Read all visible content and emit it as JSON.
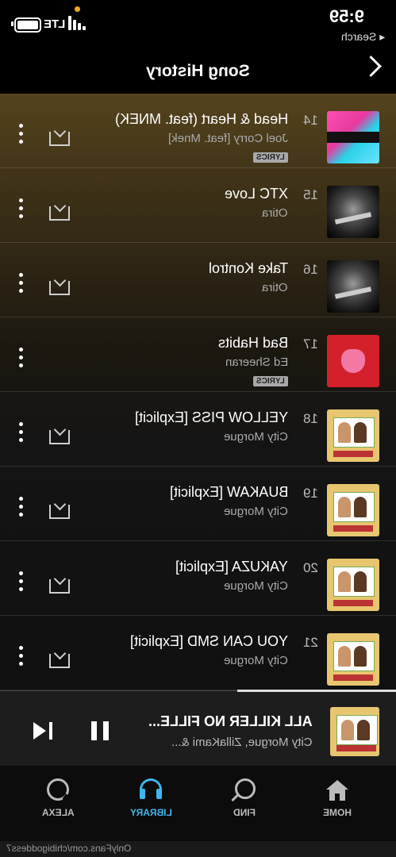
{
  "status": {
    "time": "9:59",
    "back_label": "◂ Search",
    "network": "LTE"
  },
  "header": {
    "title": "Song History"
  },
  "songs": [
    {
      "num": "14",
      "title": "Head & Heart (feat. MNEK)",
      "artist": "Joel Corry [feat. Mnek]",
      "lyrics": "LYRICS",
      "art": "head-heart",
      "download": true
    },
    {
      "num": "15",
      "title": "XTC Love",
      "artist": "Otira",
      "lyrics": "",
      "art": "otira",
      "download": true
    },
    {
      "num": "16",
      "title": "Take Kontrol",
      "artist": "Otira",
      "lyrics": "",
      "art": "otira",
      "download": true
    },
    {
      "num": "17",
      "title": "Bad Habits",
      "artist": "Ed Sheeran",
      "lyrics": "LYRICS",
      "art": "bad-habits",
      "download": false
    },
    {
      "num": "18",
      "title": "YELLOW PISS [Explicit]",
      "artist": "City Morgue",
      "lyrics": "",
      "art": "city-morgue",
      "download": true
    },
    {
      "num": "19",
      "title": "BUAKAW [Explicit]",
      "artist": "City Morgue",
      "lyrics": "",
      "art": "city-morgue",
      "download": true
    },
    {
      "num": "20",
      "title": "YAKUZA [Explicit]",
      "artist": "City Morgue",
      "lyrics": "",
      "art": "city-morgue",
      "download": true
    },
    {
      "num": "21",
      "title": "YOU CAN SMD [Explicit]",
      "artist": "City Morgue",
      "lyrics": "",
      "art": "city-morgue",
      "download": true
    }
  ],
  "now_playing": {
    "title": "ALL KILLER NO FILLE...",
    "artist": "City Morgue, ZillaKami &...",
    "progress": 0.4
  },
  "tabs": [
    {
      "label": "HOME",
      "icon": "home-icon",
      "active": false
    },
    {
      "label": "FIND",
      "icon": "search-icon",
      "active": false
    },
    {
      "label": "LIBRARY",
      "icon": "headphones-icon",
      "active": true
    },
    {
      "label": "ALEXA",
      "icon": "alexa-icon",
      "active": false
    }
  ],
  "watermark": "OnlyFans.com/chibigoddess7",
  "colors": {
    "accent": "#3fb6ee",
    "background": "#0a0a0a"
  }
}
